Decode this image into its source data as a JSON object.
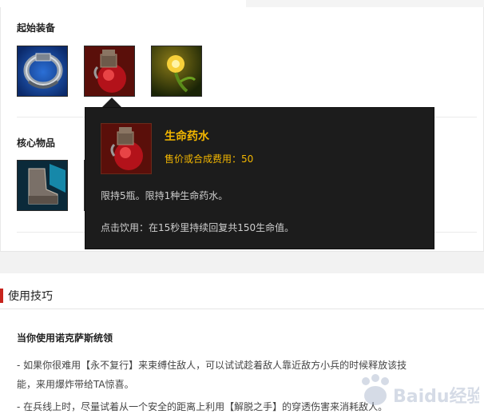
{
  "starting_items": {
    "title": "起始装备",
    "items": [
      {
        "name": "dorans-ring",
        "icon": "ring-icon"
      },
      {
        "name": "health-potion",
        "icon": "potion-icon"
      },
      {
        "name": "sight-ward",
        "icon": "ward-icon"
      }
    ]
  },
  "core_items": {
    "title": "核心物品",
    "items": [
      {
        "name": "boots",
        "icon": "boots-icon"
      },
      {
        "name": "hidden-item-2",
        "icon": "item-icon"
      },
      {
        "name": "hidden-item-3",
        "icon": "item-icon"
      },
      {
        "name": "hidden-item-4",
        "icon": "item-icon"
      }
    ]
  },
  "tooltip": {
    "name": "生命药水",
    "price": "售价或合成费用：50",
    "desc1": "限持5瓶。限持1种生命药水。",
    "desc2": "点击饮用：在15秒里持续回复共150生命值。"
  },
  "tips": {
    "title": "使用技巧",
    "subtitle": "当你使用诺克萨斯统领",
    "lines": [
      "- 如果你很难用【永不复行】来束缚住敌人，可以试试趁着敌人靠近敌方小兵的时候释放该技",
      "能，来用爆炸带给TA惊喜。",
      "- 在兵线上时，尽量试着从一个安全的距离上利用【解脱之手】的穿透伤害来消耗敌人。"
    ]
  },
  "colors": {
    "accent_red": "#c7241d",
    "tooltip_gold": "#f2b600",
    "tooltip_bg": "#1c1c1c"
  },
  "watermark": {
    "text": "Baidu经验"
  }
}
